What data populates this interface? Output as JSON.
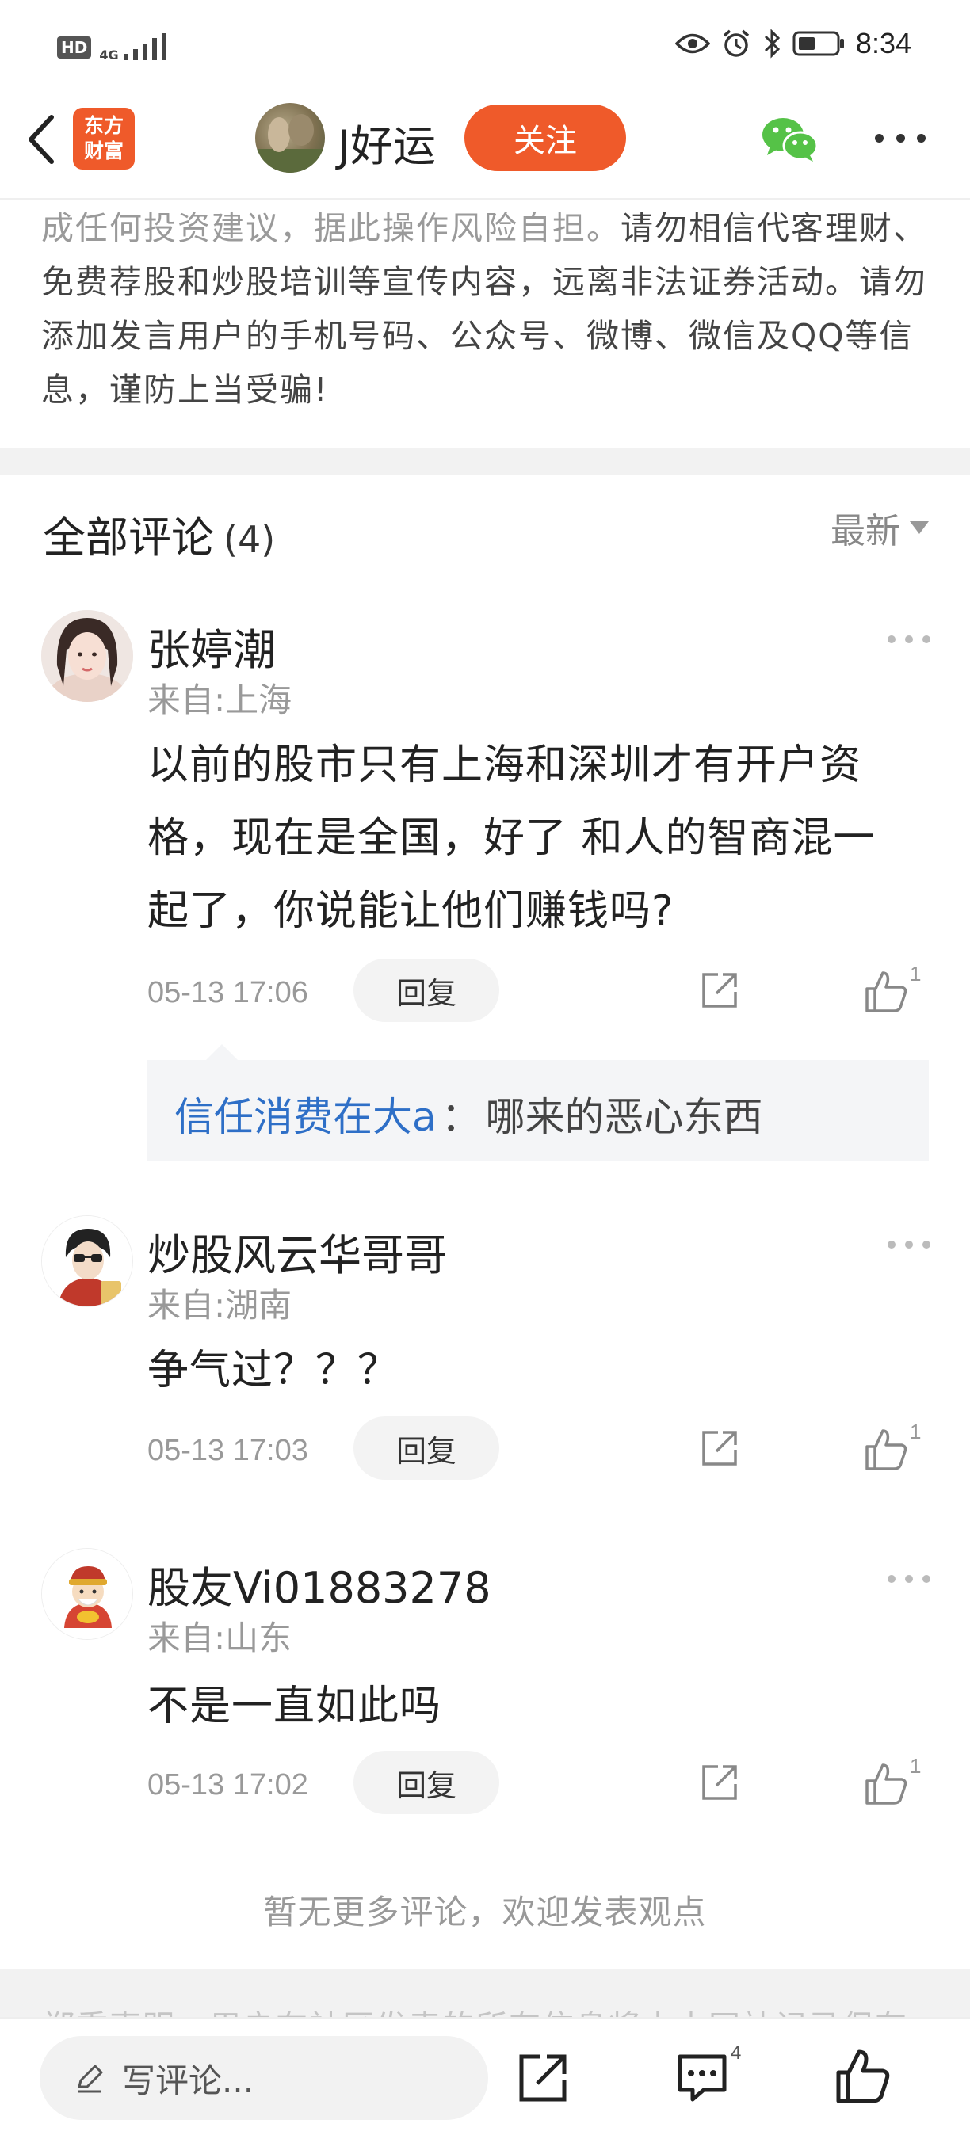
{
  "status_bar": {
    "hd_label": "HD",
    "network_label": "4G",
    "time": "8:34"
  },
  "header": {
    "logo_line1": "东方",
    "logo_line2": "财富",
    "poster_name": "J好运",
    "follow_label": "关注"
  },
  "disclaimer": {
    "gray_part": "成任何投资建议，据此操作风险自担。",
    "main_part": "请勿相信代客理财、免费荐股和炒股培训等宣传内容，远离非法证券活动。请勿添加发言用户的手机号码、公众号、微博、微信及QQ等信息，谨防上当受骗!"
  },
  "comments_header": {
    "title": "全部评论",
    "count": "(4)",
    "sort_label": "最新"
  },
  "comments": [
    {
      "name": "张婷潮",
      "location": "来自:上海",
      "lines": [
        "以前的股市只有上海和深圳才有开户资",
        "格，现在是全国，好了 和人的智商混一",
        "起了，你说能让他们赚钱吗?"
      ],
      "time": "05-13 17:06",
      "reply_label": "回复",
      "likes": "1",
      "reply": {
        "user": "信任消费在大a",
        "separator": "：",
        "text": "哪来的恶心东西"
      }
    },
    {
      "name": "炒股风云华哥哥",
      "location": "来自:湖南",
      "lines": [
        "争气过？？？"
      ],
      "time": "05-13 17:03",
      "reply_label": "回复",
      "likes": "1"
    },
    {
      "name": "股友Vi01883278",
      "location": "来自:山东",
      "lines": [
        "不是一直如此吗"
      ],
      "time": "05-13 17:02",
      "reply_label": "回复",
      "likes": "1"
    }
  ],
  "no_more_text": "暂无更多评论，欢迎发表观点",
  "faded_text": "郑重声明：用户在社区发表的所有信息将由本网站记录保存",
  "bottom_bar": {
    "input_placeholder": "写评论...",
    "comment_badge": "4"
  },
  "colors": {
    "accent": "#ef5a2a",
    "reply_user": "#2e6fc7",
    "wechat": "#55c247"
  }
}
